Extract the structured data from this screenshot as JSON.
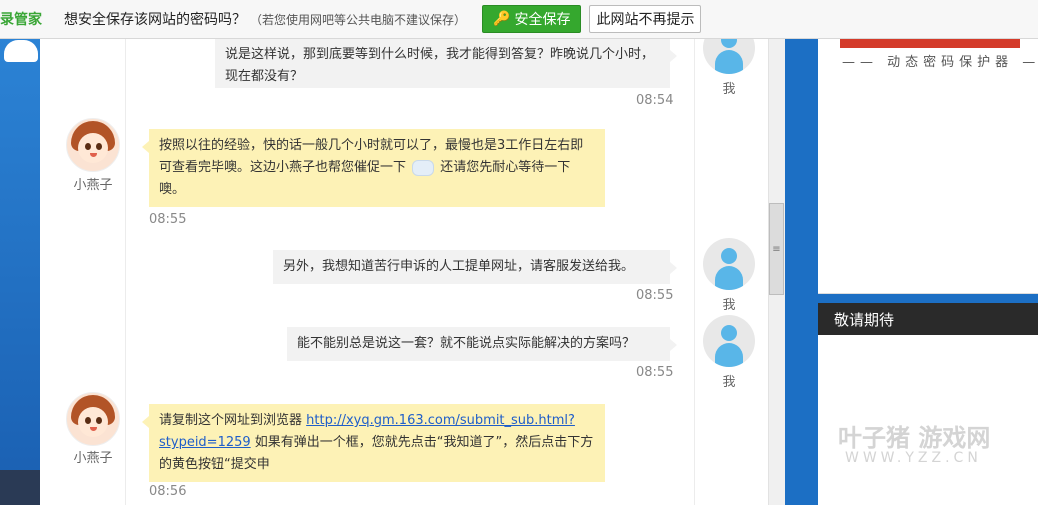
{
  "password_bar": {
    "brand": "录管家",
    "question": "想安全保存该网站的密码吗？",
    "note": "（若您使用网吧等公共电脑不建议保存）",
    "save_button": "安全保存",
    "never_button": "此网站不再提示"
  },
  "chat": {
    "me_name": "我",
    "agent_name": "小燕子",
    "messages": [
      {
        "from": "me",
        "text": "说是这样说，那到底要等到什么时候，我才能得到答复？昨晚说几个小时，现在都没有？",
        "time": "08:54"
      },
      {
        "from": "agent",
        "text_a": "按照以往的经验，快的话一般几个小时就可以了，最慢也是3工作日左右即可查看完毕噢。这边小燕子也帮您催促一下",
        "text_b": "还请您先耐心等待一下噢。",
        "time": "08:55"
      },
      {
        "from": "me",
        "text": "另外，我想知道苦行申诉的人工提单网址，请客服发送给我。",
        "time": "08:55"
      },
      {
        "from": "me",
        "text": "能不能别总是说这一套？就不能说点实际能解决的方案吗？",
        "time": "08:55"
      },
      {
        "from": "agent",
        "text_a": "请复制这个网址到浏览器",
        "link": "http://xyq.gm.163.com/submit_sub.html?stypeid=1259",
        "text_b": "如果有弹出一个框，您就先点击“我知道了”，然后点击下方的黄色按钮“提交申",
        "time": "08:56"
      }
    ]
  },
  "sidebar": {
    "security_caption": "—— 动态密码保护器 —",
    "pending_title": "敬请期待",
    "watermark_main": "叶子猪 游戏网",
    "watermark_sub": "WWW.YZZ.CN"
  },
  "icons": {
    "save": "key-icon",
    "scroll_grip": "grip-icon"
  },
  "colors": {
    "save_green": "#35a82e",
    "agent_bubble": "#fdf2b6",
    "me_bubble": "#f2f2f2",
    "link": "#1f5ec9"
  }
}
